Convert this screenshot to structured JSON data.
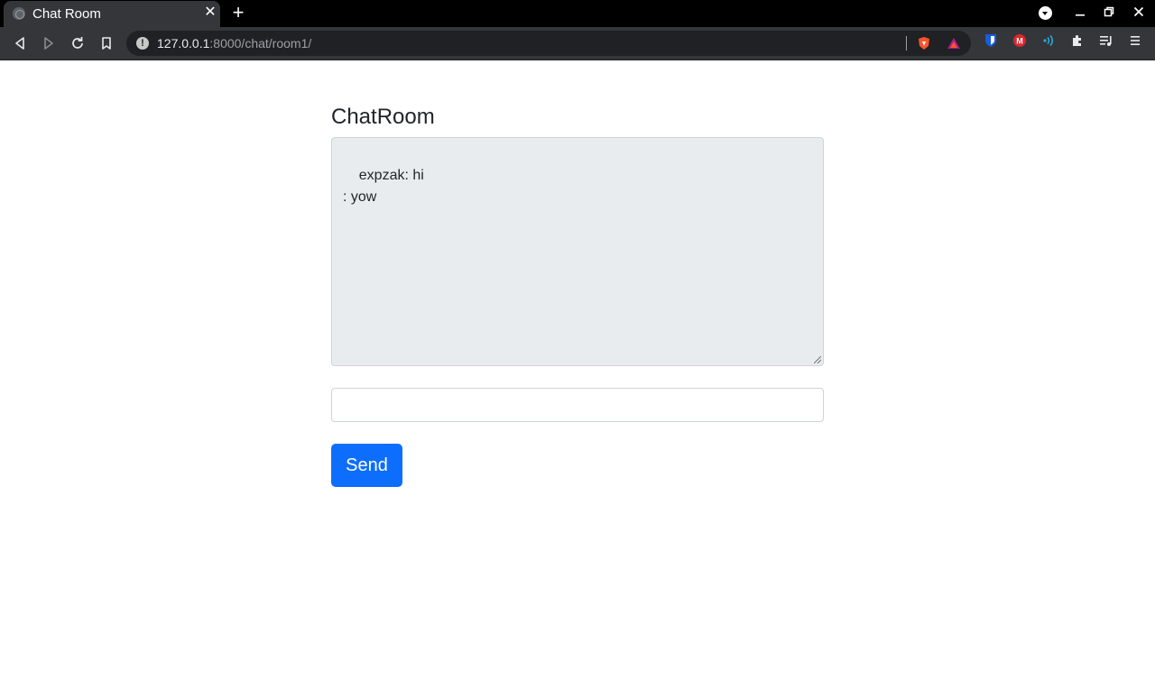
{
  "browser": {
    "tab_title": "Chat Room",
    "url_host": "127.0.0.1",
    "url_rest": ":8000/chat/room1/",
    "extensions": [
      "brave-shield-icon",
      "brave-rewards-icon",
      "bitwarden-icon",
      "mega-icon",
      "wifi-extension-icon",
      "extensions-puzzle-icon",
      "media-queue-icon",
      "menu-icon"
    ]
  },
  "page": {
    "heading": "ChatRoom",
    "chat_log": "expzak: hi\n: yow",
    "message_input_value": "",
    "send_label": "Send"
  },
  "colors": {
    "primary": "#0d6efd",
    "chat_bg": "#e9ecef",
    "text": "#212529"
  }
}
